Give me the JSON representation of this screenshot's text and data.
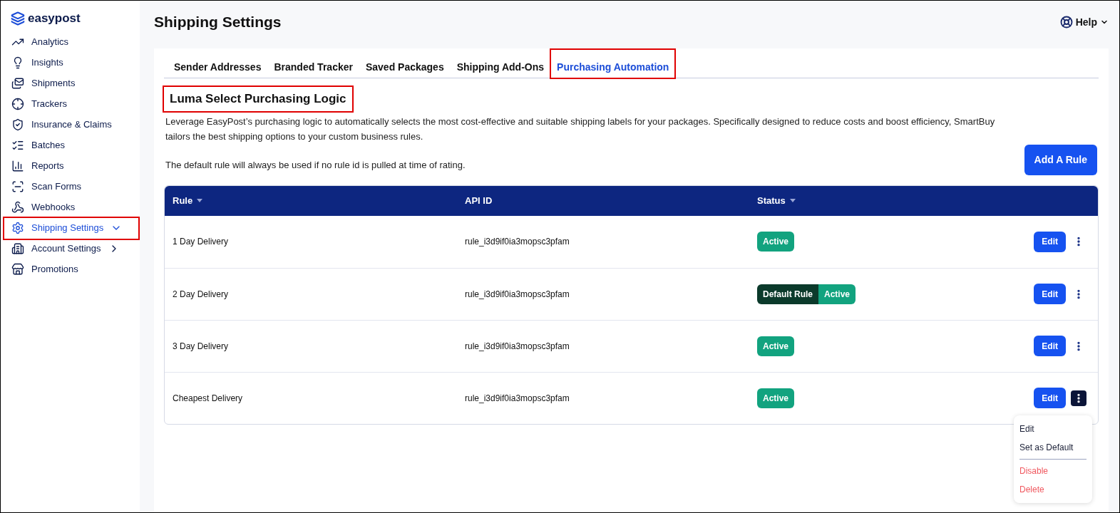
{
  "brand": "easypost",
  "nav": [
    {
      "label": "Analytics",
      "selected": false,
      "highlighted": false
    },
    {
      "label": "Insights",
      "selected": false,
      "highlighted": false
    },
    {
      "label": "Shipments",
      "selected": false,
      "highlighted": false
    },
    {
      "label": "Trackers",
      "selected": false,
      "highlighted": false
    },
    {
      "label": "Insurance & Claims",
      "selected": false,
      "highlighted": false
    },
    {
      "label": "Batches",
      "selected": false,
      "highlighted": false
    },
    {
      "label": "Reports",
      "selected": false,
      "highlighted": false
    },
    {
      "label": "Scan Forms",
      "selected": false,
      "highlighted": false
    },
    {
      "label": "Webhooks",
      "selected": false,
      "highlighted": false
    },
    {
      "label": "Shipping Settings",
      "selected": true,
      "highlighted": true,
      "expanded": true
    },
    {
      "label": "Account Settings",
      "selected": false,
      "highlighted": false,
      "expanded": false
    },
    {
      "label": "Promotions",
      "selected": false,
      "highlighted": false
    }
  ],
  "page_title": "Shipping Settings",
  "help": "Help",
  "tabs": [
    {
      "label": "Sender Addresses",
      "selected": false,
      "highlighted": false
    },
    {
      "label": "Branded Tracker",
      "selected": false,
      "highlighted": false
    },
    {
      "label": "Saved Packages",
      "selected": false,
      "highlighted": false
    },
    {
      "label": "Shipping Add-Ons",
      "selected": false,
      "highlighted": false
    },
    {
      "label": "Purchasing Automation",
      "selected": true,
      "highlighted": true
    }
  ],
  "section": {
    "title": "Luma Select Purchasing Logic",
    "highlighted": true,
    "description": "Leverage EasyPost’s purchasing logic to automatically selects the most cost-effective and suitable shipping labels for your packages. Specifically designed to reduce costs and boost efficiency, SmartBuy tailors the best shipping options to your custom business rules.",
    "note": "The default rule will always be used if no rule id is pulled at time of rating.",
    "add_button": "Add A Rule"
  },
  "table": {
    "columns": [
      {
        "label": "Rule",
        "sortable": true
      },
      {
        "label": "API ID",
        "sortable": false
      },
      {
        "label": "Status",
        "sortable": true
      }
    ],
    "rows": [
      {
        "rule": "1 Day Delivery",
        "api_id": "rule_i3d9if0ia3mopsc3pfam",
        "badges": [
          {
            "label": "Active",
            "kind": "active"
          }
        ],
        "edit": "Edit",
        "menu_open": false
      },
      {
        "rule": "2 Day Delivery",
        "api_id": "rule_i3d9if0ia3mopsc3pfam",
        "badges": [
          {
            "label": "Default Rule",
            "kind": "default"
          },
          {
            "label": "Active",
            "kind": "active"
          }
        ],
        "edit": "Edit",
        "menu_open": false
      },
      {
        "rule": "3 Day Delivery",
        "api_id": "rule_i3d9if0ia3mopsc3pfam",
        "badges": [
          {
            "label": "Active",
            "kind": "active"
          }
        ],
        "edit": "Edit",
        "menu_open": false
      },
      {
        "rule": "Cheapest Delivery",
        "api_id": "rule_i3d9if0ia3mopsc3pfam",
        "badges": [
          {
            "label": "Active",
            "kind": "active"
          }
        ],
        "edit": "Edit",
        "menu_open": true
      }
    ]
  },
  "menu": {
    "groups": [
      [
        {
          "label": "Edit",
          "kind": "normal"
        },
        {
          "label": "Set as Default",
          "kind": "normal"
        }
      ],
      [
        {
          "label": "Disable",
          "kind": "danger"
        },
        {
          "label": "Delete",
          "kind": "danger"
        }
      ]
    ]
  }
}
